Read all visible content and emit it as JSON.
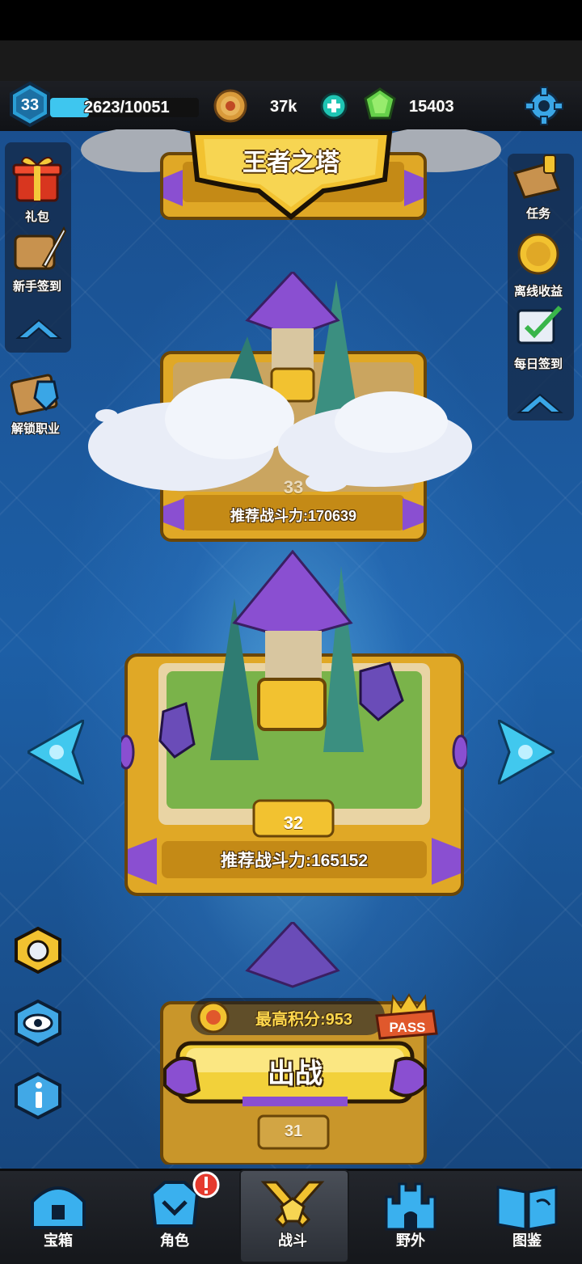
{
  "player": {
    "level": "33",
    "xp_text": "2623/10051",
    "xp_fraction": 0.26
  },
  "currency": {
    "coins": "37k",
    "gems": "15403"
  },
  "title": "王者之塔",
  "left_menu": [
    {
      "label": "礼包",
      "icon": "gift-box-icon"
    },
    {
      "label": "新手签到",
      "icon": "scroll-quill-icon"
    },
    {
      "label": "解锁职业",
      "icon": "unlock-class-icon"
    }
  ],
  "right_menu": [
    {
      "label": "任务",
      "icon": "quest-map-icon"
    },
    {
      "label": "离线收益",
      "icon": "gold-coin-icon"
    },
    {
      "label": "每日签到",
      "icon": "daily-checkin-icon"
    }
  ],
  "levels": {
    "upper": {
      "level": "33",
      "power_text": "推荐战斗力:170639"
    },
    "current": {
      "level": "32",
      "power_text": "推荐战斗力:165152"
    },
    "lower": {
      "level": "31"
    }
  },
  "best_score_text": "最高积分:953",
  "pass_label": "PASS",
  "fight_button": "出战",
  "nav": [
    {
      "label": "宝箱",
      "icon": "treasure-chest-icon"
    },
    {
      "label": "角色",
      "icon": "character-helmet-icon"
    },
    {
      "label": "战斗",
      "icon": "crossed-swords-icon"
    },
    {
      "label": "野外",
      "icon": "castle-icon"
    },
    {
      "label": "图鉴",
      "icon": "codex-book-icon"
    }
  ],
  "colors": {
    "accent_gold": "#f2c230",
    "xp_blue": "#3ec6ef",
    "frame_gold": "#e0a826",
    "crystal_purple": "#8a4fd1"
  }
}
